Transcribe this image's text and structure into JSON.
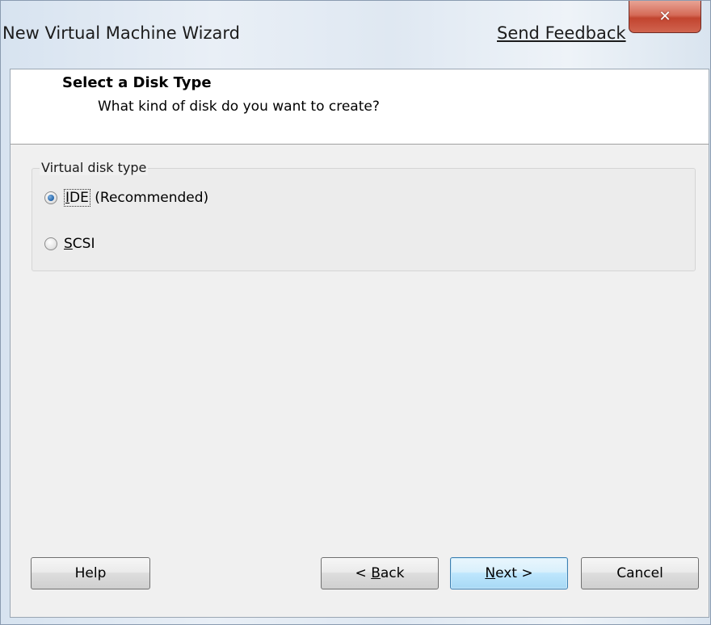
{
  "window": {
    "title": "New Virtual Machine Wizard",
    "feedback_link": "Send Feedback",
    "close_glyph": "✕"
  },
  "header": {
    "title": "Select a Disk Type",
    "subtitle": "What kind of disk do you want to create?"
  },
  "disk_type_group": {
    "label": "Virtual disk type",
    "options": [
      {
        "mnemonic": "I",
        "rest": "DE",
        "suffix": " (Recommended)",
        "selected": true,
        "focused": true
      },
      {
        "mnemonic": "S",
        "rest": "CSI",
        "suffix": "",
        "selected": false,
        "focused": false
      }
    ]
  },
  "buttons": {
    "help": "Help",
    "back_prefix": "< ",
    "back_mnemonic": "B",
    "back_rest": "ack",
    "next_mnemonic": "N",
    "next_rest": "ext >",
    "cancel": "Cancel"
  },
  "colors": {
    "close_button": "#c2442f",
    "radio_selected": "#2e6fb3",
    "default_button_border": "#3c7fb1"
  }
}
